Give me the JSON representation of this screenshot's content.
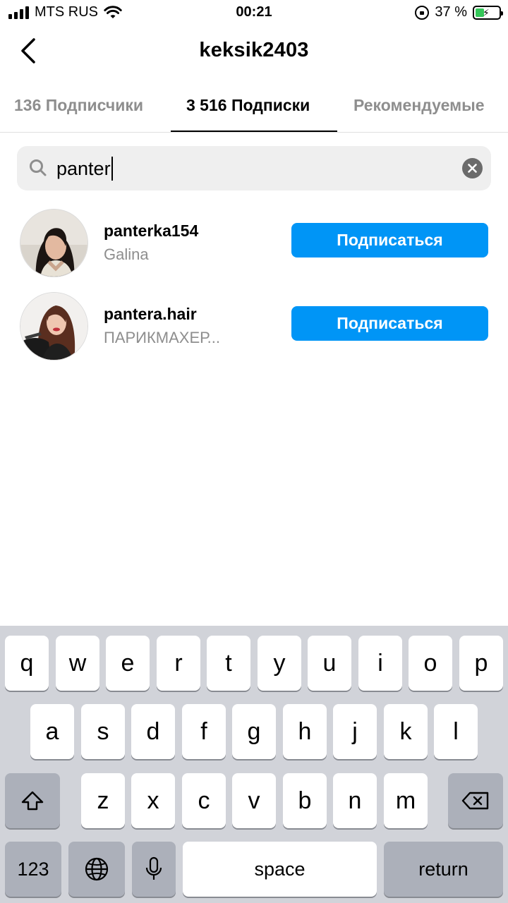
{
  "status_bar": {
    "carrier": "MTS RUS",
    "time": "00:21",
    "battery_percent": "37 %",
    "battery_level": 0.37
  },
  "header": {
    "title": "keksik2403"
  },
  "tabs": [
    {
      "label": "136 Подписчики",
      "active": false
    },
    {
      "label": "3 516 Подписки",
      "active": true
    },
    {
      "label": "Рекомендуемые",
      "active": false
    }
  ],
  "search": {
    "value": "panter"
  },
  "results": [
    {
      "username": "panterka154",
      "full_name": "Galina",
      "button": "Подписаться"
    },
    {
      "username": "pantera.hair",
      "full_name": "ПАРИКМАХЕР...",
      "button": "Подписаться"
    }
  ],
  "keyboard": {
    "row1": [
      "q",
      "w",
      "e",
      "r",
      "t",
      "y",
      "u",
      "i",
      "o",
      "p"
    ],
    "row2": [
      "a",
      "s",
      "d",
      "f",
      "g",
      "h",
      "j",
      "k",
      "l"
    ],
    "row3": [
      "z",
      "x",
      "c",
      "v",
      "b",
      "n",
      "m"
    ],
    "numbers_label": "123",
    "space_label": "space",
    "return_label": "return"
  },
  "colors": {
    "accent": "#0095f6",
    "battery": "#34c759"
  }
}
